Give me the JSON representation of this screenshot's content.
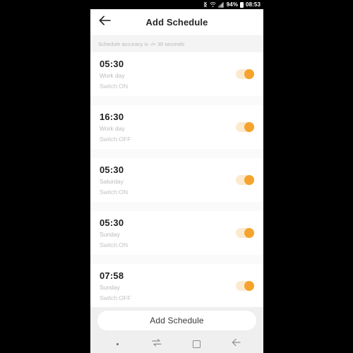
{
  "status_bar": {
    "bluetooth_icon": "bluetooth-icon",
    "wifi_icon": "wifi-icon",
    "signal_icon": "signal-icon",
    "battery_percent": "94%",
    "battery_icon": "battery-icon",
    "clock": "08:53"
  },
  "app_bar": {
    "back_icon": "back-arrow-icon",
    "title": "Add Schedule"
  },
  "notice": {
    "text": "Schedule accuracy is -/+ 30 seconds"
  },
  "schedules": [
    {
      "time": "05:30",
      "day": "Work day",
      "switch_label": "Switch:ON",
      "enabled": true
    },
    {
      "time": "16:30",
      "day": "Work day",
      "switch_label": "Switch:OFF",
      "enabled": true
    },
    {
      "time": "05:30",
      "day": "Saturday",
      "switch_label": "Switch:ON",
      "enabled": true
    },
    {
      "time": "05:30",
      "day": "Sunday",
      "switch_label": "Switch:ON",
      "enabled": true
    },
    {
      "time": "07:58",
      "day": "Sunday",
      "switch_label": "Switch:OFF",
      "enabled": true
    }
  ],
  "bottom_action": {
    "add_label": "Add Schedule"
  },
  "nav_bar": {
    "items": [
      {
        "icon": "dot-icon"
      },
      {
        "icon": "swap-recents-icon"
      },
      {
        "icon": "home-square-icon"
      },
      {
        "icon": "back-arrow-icon"
      }
    ]
  },
  "colors": {
    "accent_orange": "#f6a32e",
    "toggle_track": "#fbeacf",
    "banner_bg": "#f4f4f4",
    "list_bg": "#fafafa",
    "bottom_bg": "#efefef"
  }
}
